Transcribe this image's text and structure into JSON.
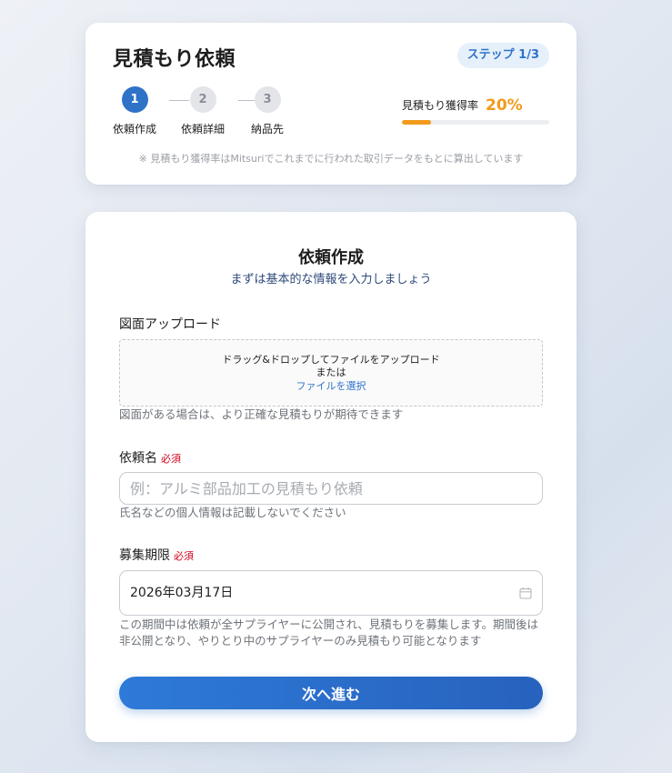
{
  "header": {
    "title": "見積もり依頼",
    "step_badge": "ステップ 1/3",
    "steps": [
      {
        "number": "1",
        "label": "依頼作成",
        "state": "active"
      },
      {
        "number": "2",
        "label": "依頼詳細",
        "state": "inactive"
      },
      {
        "number": "3",
        "label": "納品先",
        "state": "inactive"
      }
    ],
    "rate_label": "見積もり獲得率",
    "rate_value": "20%",
    "rate_progress_percent": 20,
    "rate_note": "※ 見積もり獲得率はMitsuriでこれまでに行われた取引データをもとに算出しています"
  },
  "form": {
    "title": "依頼作成",
    "subtitle": "まずは基本的な情報を入力しましょう",
    "upload": {
      "label": "図面アップロード",
      "drop_text": "ドラッグ&ドロップしてファイルをアップロード",
      "or_text": "または",
      "select_link": "ファイルを選択",
      "help": "図面がある場合は、より正確な見積もりが期待できます"
    },
    "request_name": {
      "label": "依頼名",
      "required": "必須",
      "value": "",
      "placeholder": "例：アルミ部品加工の見積もり依頼",
      "help": "氏名などの個人情報は記載しないでください"
    },
    "deadline": {
      "label": "募集期限",
      "required": "必須",
      "value": "2026年03月17日",
      "icon": "calendar-icon",
      "help": "この期間中は依頼が全サプライヤーに公開され、見積もりを募集します。期間後は非公開となり、やりとり中のサプライヤーのみ見積もり可能となります"
    },
    "next_button": "次へ進む"
  },
  "colors": {
    "accent": "#2f73c9",
    "rate": "#f29a1b",
    "required": "#d0021b"
  }
}
